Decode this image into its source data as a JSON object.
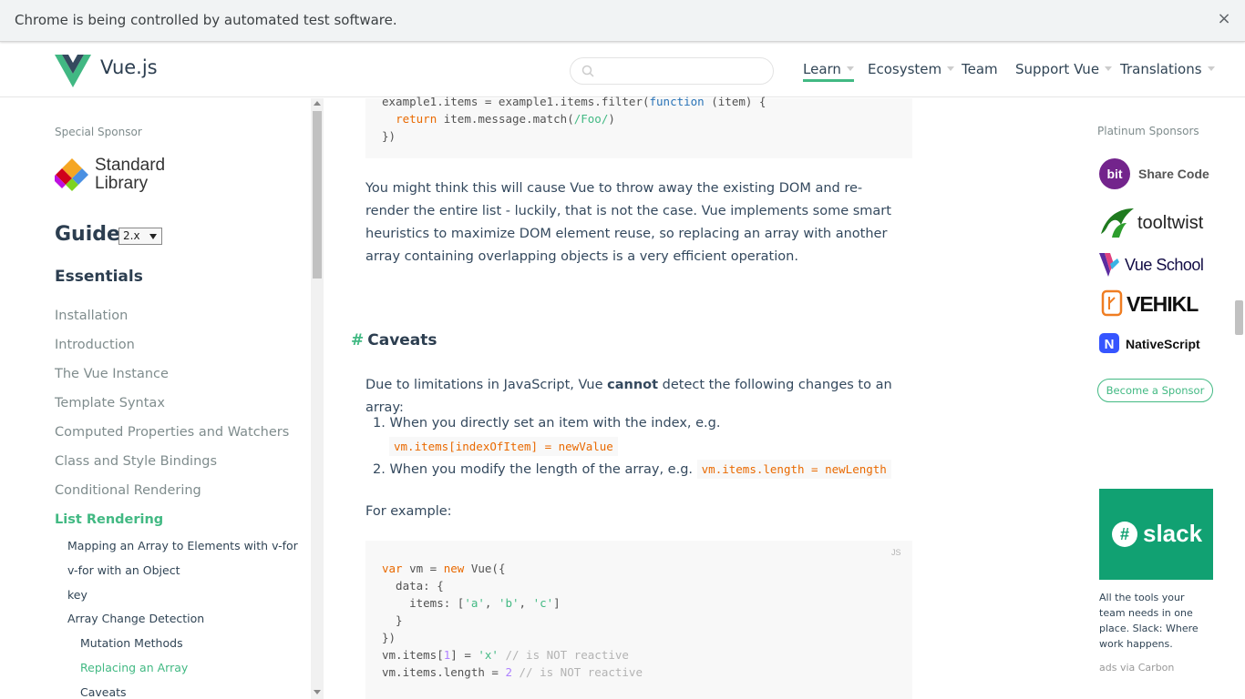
{
  "automation_bar": {
    "text": "Chrome is being controlled by automated test software.",
    "close": "×"
  },
  "header": {
    "logo_text": "Vue.js",
    "search_placeholder": "",
    "nav": [
      {
        "label": "Learn"
      },
      {
        "label": "Ecosystem"
      },
      {
        "label": "Team"
      },
      {
        "label": "Support Vue"
      },
      {
        "label": "Translations"
      }
    ]
  },
  "sidebar": {
    "special_sponsor_label": "Special Sponsor",
    "sponsor_name_1": "Standard",
    "sponsor_name_2": "Library",
    "guide_title": "Guide",
    "version": "2.x",
    "section": "Essentials",
    "links": [
      "Installation",
      "Introduction",
      "The Vue Instance",
      "Template Syntax",
      "Computed Properties and Watchers",
      "Class and Style Bindings",
      "Conditional Rendering",
      "List Rendering"
    ],
    "sub_links": [
      "Mapping an Array to Elements with v-for",
      "v-for with an Object",
      "key",
      "Array Change Detection"
    ],
    "sub_sub_links": [
      "Mutation Methods",
      "Replacing an Array",
      "Caveats"
    ]
  },
  "main": {
    "code1": {
      "line1_a": "example1.items = example1.items.filter(",
      "line1_kw": "function",
      "line1_b": " (item) {",
      "line2_kw": "return",
      "line2_a": " item.message.match(",
      "line2_str": "/Foo/",
      "line2_b": ")",
      "line3": "})"
    },
    "para1": "You might think this will cause Vue to throw away the existing DOM and re-render the entire list - luckily, that is not the case. Vue implements some smart heuristics to maximize DOM element reuse, so replacing an array with another array containing overlapping objects is a very efficient operation.",
    "caveats_heading": "Caveats",
    "caveats_hash": "#",
    "caveats_intro_a": "Due to limitations in JavaScript, Vue ",
    "caveats_intro_b": "cannot",
    "caveats_intro_c": " detect the following changes to an array:",
    "li1_text": "When you directly set an item with the index, e.g.",
    "li1_code": "vm.items[indexOfItem] = newValue",
    "li2_text": "When you modify the length of the array, e.g.",
    "li2_code": "vm.items.length = newLength",
    "li1_num": "1.",
    "li2_num": "2.",
    "for_example": "For example:",
    "code2_lang": "JS",
    "code2": {
      "l1_kw1": "var",
      "l1_a": " vm = ",
      "l1_kw2": "new",
      "l1_b": " Vue({",
      "l2": "  data: {",
      "l3_a": "    items: [",
      "l3_s1": "'a'",
      "l3_c1": ", ",
      "l3_s2": "'b'",
      "l3_c2": ", ",
      "l3_s3": "'c'",
      "l3_b": "]",
      "l4": "  }",
      "l5": "})",
      "l6_a": "vm.items[",
      "l6_n": "1",
      "l6_b": "] = ",
      "l6_s": "'x'",
      "l6_cmt": " // is NOT reactive",
      "l7_a": "vm.items.length = ",
      "l7_n": "2",
      "l7_cmt": " // is NOT reactive"
    }
  },
  "right": {
    "platinum_label": "Platinum Sponsors",
    "sponsors": [
      "bit Share Code",
      "tooltwist",
      "Vue School",
      "VEHIKL",
      "NativeScript"
    ],
    "become_sponsor": "Become a Sponsor",
    "slack_logo": "slack",
    "slack_text": "All the tools your team needs in one place. Slack: Where work happens.",
    "carbon": "ads via Carbon"
  },
  "colors": {
    "accent": "#42b983",
    "text": "#34495e",
    "code_bg": "#f8f8f8"
  }
}
